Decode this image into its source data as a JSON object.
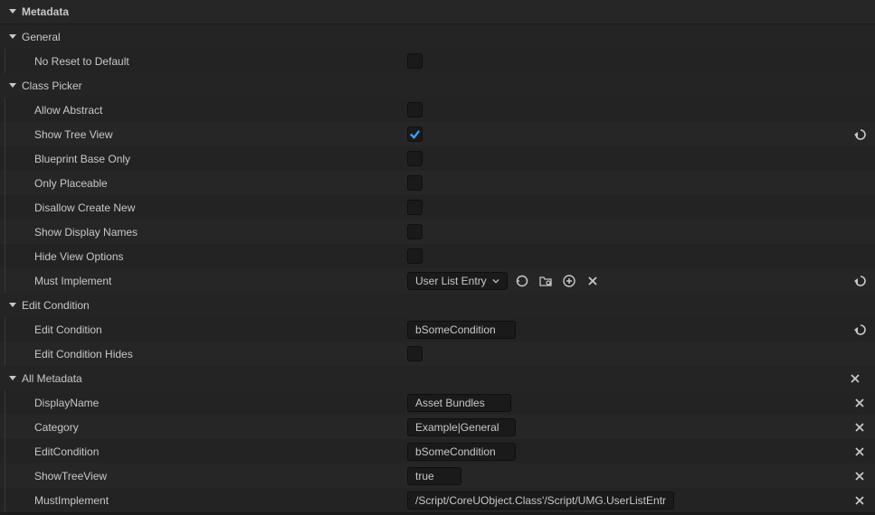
{
  "header": {
    "title": "Metadata"
  },
  "groups": {
    "general": {
      "title": "General",
      "rows": {
        "noReset": {
          "label": "No Reset to Default",
          "checked": false
        }
      }
    },
    "classPicker": {
      "title": "Class Picker",
      "rows": {
        "allowAbstract": {
          "label": "Allow Abstract",
          "checked": false
        },
        "showTreeView": {
          "label": "Show Tree View",
          "checked": true,
          "hasReset": true
        },
        "blueprintBaseOnly": {
          "label": "Blueprint Base Only",
          "checked": false
        },
        "onlyPlaceable": {
          "label": "Only Placeable",
          "checked": false
        },
        "disallowCreateNew": {
          "label": "Disallow Create New",
          "checked": false
        },
        "showDisplayNames": {
          "label": "Show Display Names",
          "checked": false
        },
        "hideViewOptions": {
          "label": "Hide View Options",
          "checked": false
        },
        "mustImplement": {
          "label": "Must Implement",
          "value": "User List Entry",
          "hasReset": true
        }
      }
    },
    "editCondition": {
      "title": "Edit Condition",
      "rows": {
        "editCondition": {
          "label": "Edit Condition",
          "value": "bSomeCondition",
          "hasReset": true
        },
        "editConditionHides": {
          "label": "Edit Condition Hides",
          "checked": false
        }
      }
    },
    "allMetadata": {
      "title": "All Metadata",
      "rows": {
        "displayName": {
          "label": "DisplayName",
          "value": "Asset Bundles"
        },
        "category": {
          "label": "Category",
          "value": "Example|General"
        },
        "editConditionMeta": {
          "label": "EditCondition",
          "value": "bSomeCondition"
        },
        "showTreeViewMeta": {
          "label": "ShowTreeView",
          "value": "true"
        },
        "mustImplementMeta": {
          "label": "MustImplement",
          "value": "/Script/CoreUObject.Class'/Script/UMG.UserListEntry'"
        }
      }
    }
  }
}
